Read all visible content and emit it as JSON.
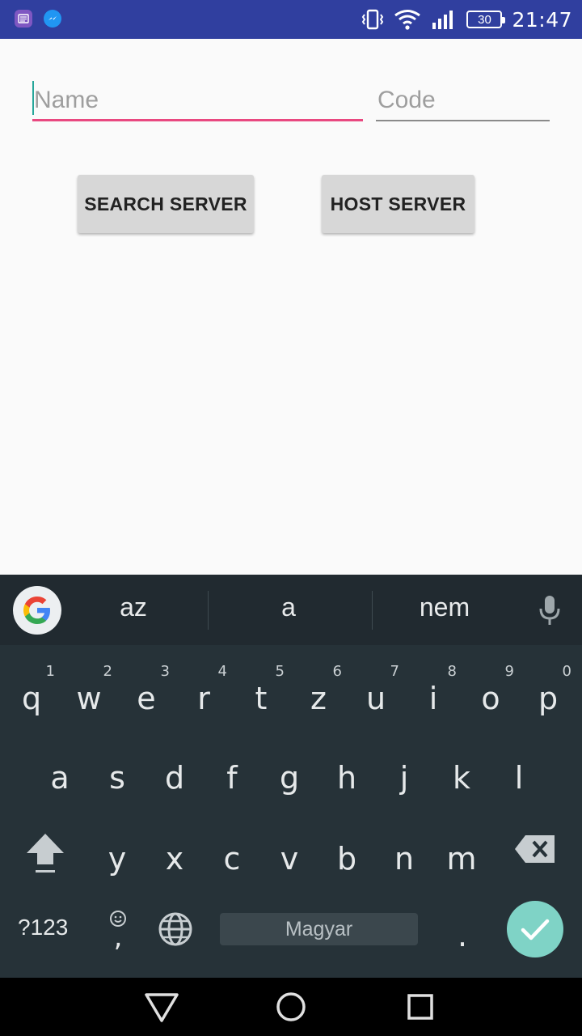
{
  "status_bar": {
    "time": "21:47",
    "battery": "30",
    "icons": [
      "notes-app-icon",
      "messenger-icon",
      "vibrate-icon",
      "wifi-icon",
      "signal-icon",
      "battery-icon"
    ]
  },
  "form": {
    "name_placeholder": "Name",
    "code_placeholder": "Code",
    "name_value": "",
    "code_value": ""
  },
  "buttons": {
    "search": "SEARCH SERVER",
    "host": "HOST SERVER"
  },
  "keyboard": {
    "suggestions": [
      "az",
      "a",
      "nem"
    ],
    "row1": [
      {
        "key": "q",
        "hint": "1"
      },
      {
        "key": "w",
        "hint": "2"
      },
      {
        "key": "e",
        "hint": "3"
      },
      {
        "key": "r",
        "hint": "4"
      },
      {
        "key": "t",
        "hint": "5"
      },
      {
        "key": "z",
        "hint": "6"
      },
      {
        "key": "u",
        "hint": "7"
      },
      {
        "key": "i",
        "hint": "8"
      },
      {
        "key": "o",
        "hint": "9"
      },
      {
        "key": "p",
        "hint": "0"
      }
    ],
    "row2": [
      "a",
      "s",
      "d",
      "f",
      "g",
      "h",
      "j",
      "k",
      "l"
    ],
    "row3": [
      "y",
      "x",
      "c",
      "v",
      "b",
      "n",
      "m"
    ],
    "symbols_label": "?123",
    "comma_label": ",",
    "period_label": ".",
    "space_label": "Magyar"
  },
  "colors": {
    "status_bar": "#303f9f",
    "accent": "#e94880",
    "caret": "#26a69a",
    "enter_key": "#7fd3c6"
  }
}
